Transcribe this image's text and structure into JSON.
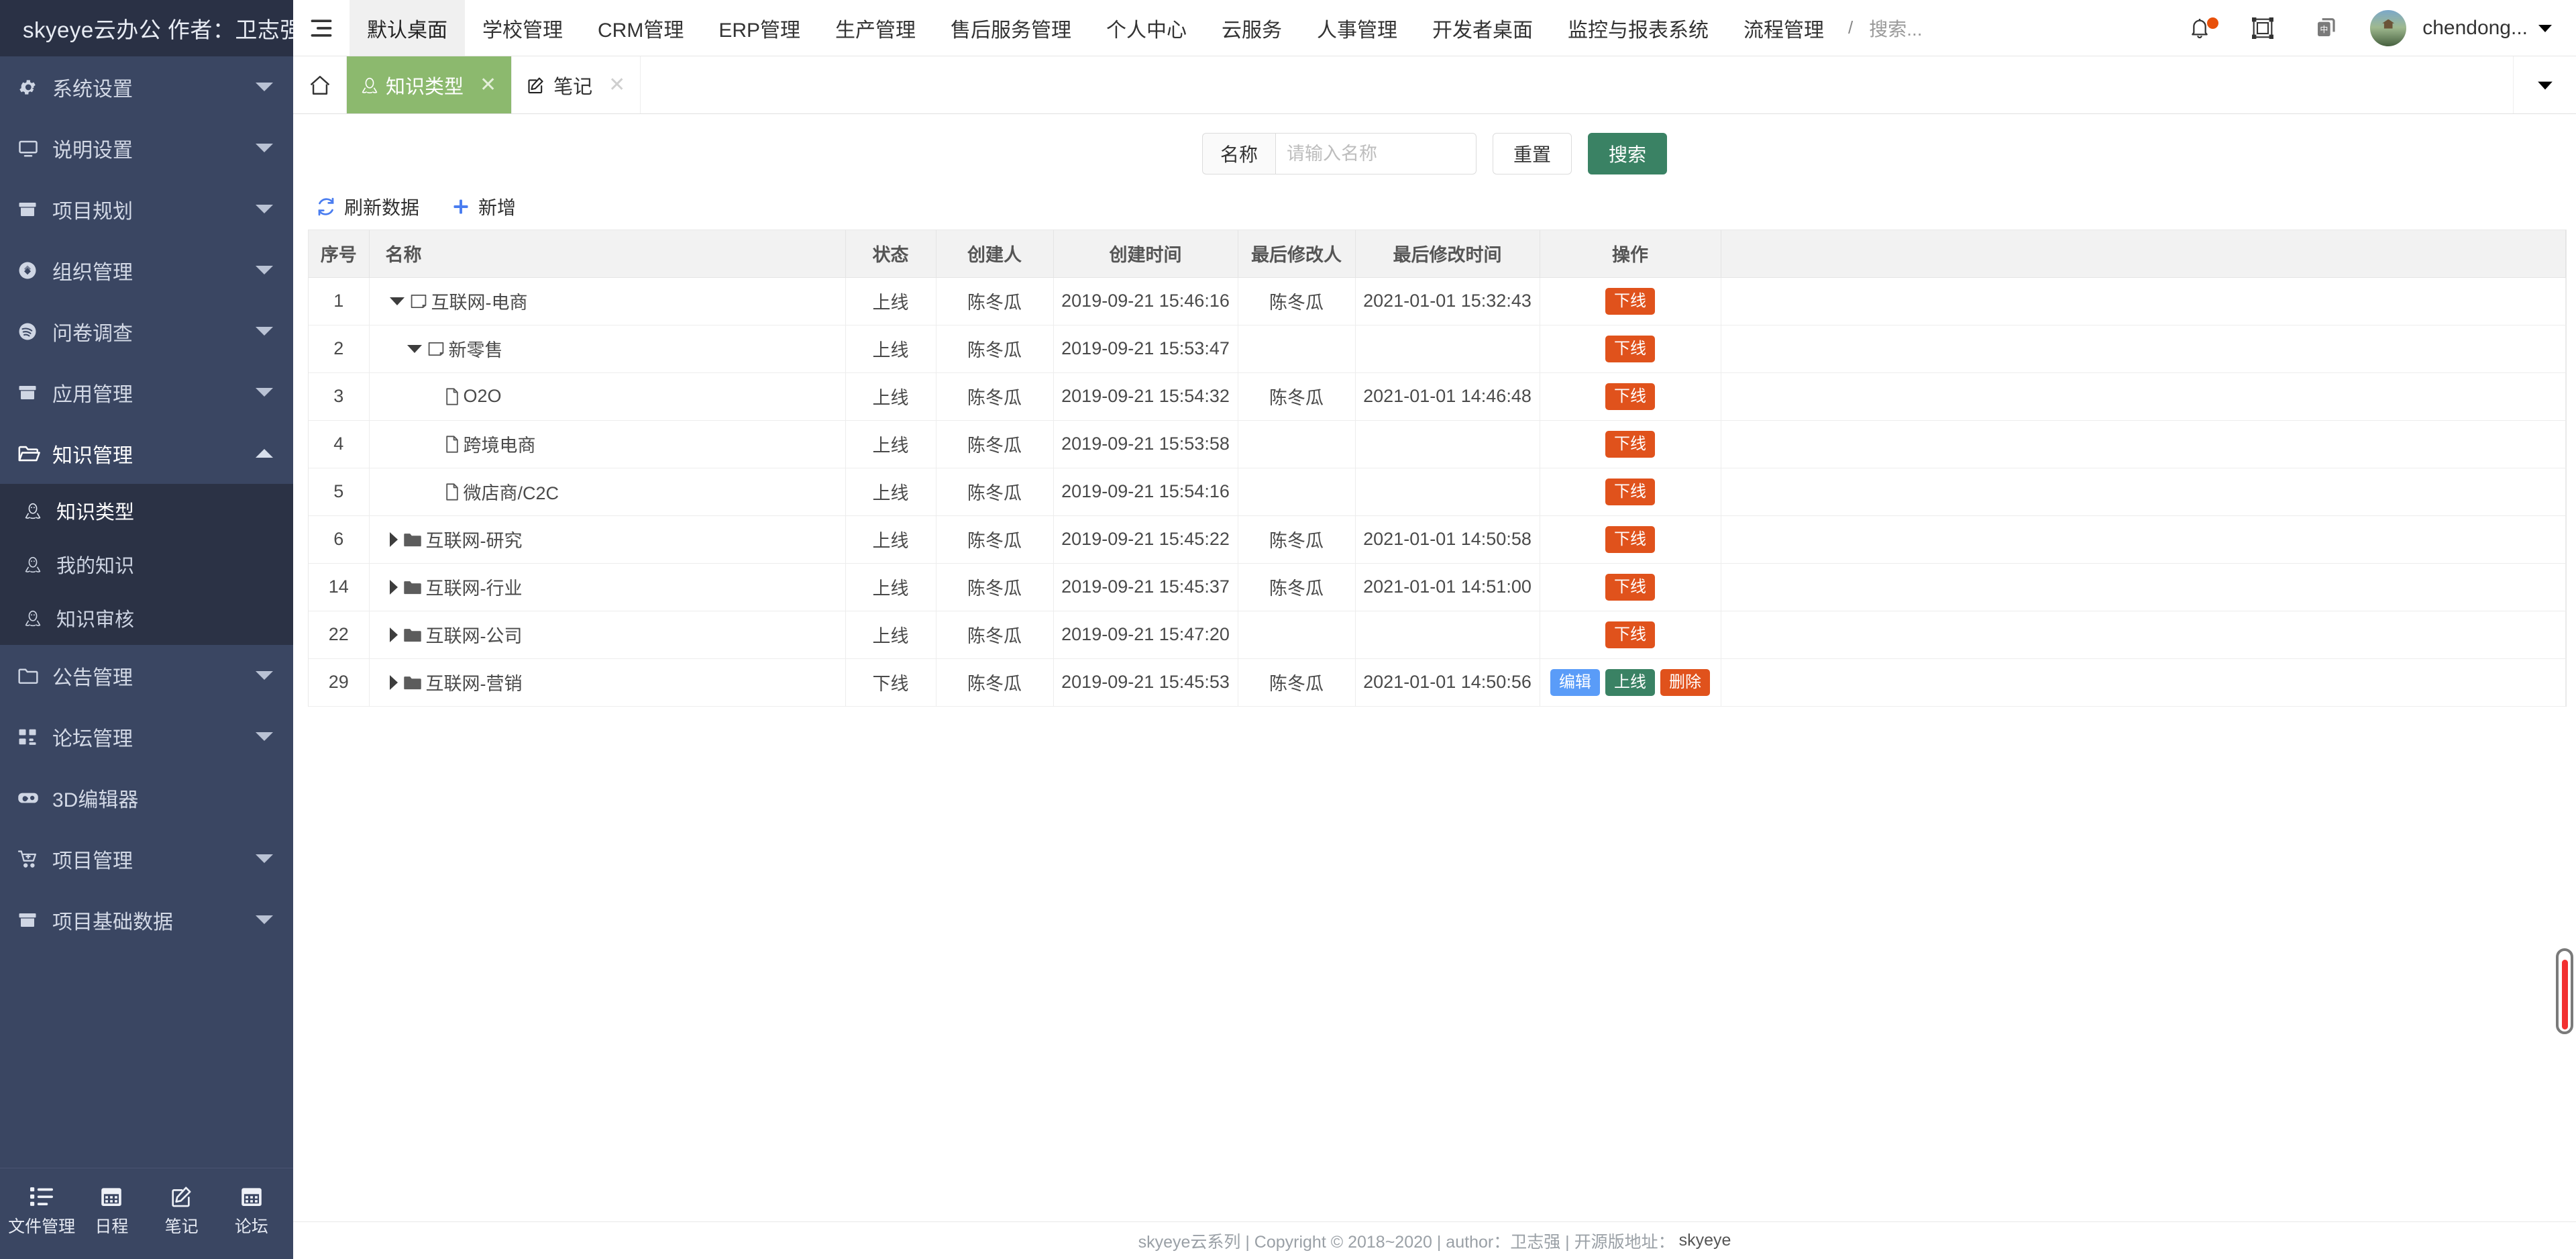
{
  "brand": {
    "title": "skyeye云办公 作者：卫志强"
  },
  "topnav": {
    "hamburger_icon": "hamburger-icon",
    "items": [
      {
        "label": "默认桌面",
        "active": true
      },
      {
        "label": "学校管理",
        "active": false
      },
      {
        "label": "CRM管理",
        "active": false
      },
      {
        "label": "ERP管理",
        "active": false
      },
      {
        "label": "生产管理",
        "active": false
      },
      {
        "label": "售后服务管理",
        "active": false
      },
      {
        "label": "个人中心",
        "active": false
      },
      {
        "label": "云服务",
        "active": false
      },
      {
        "label": "人事管理",
        "active": false
      },
      {
        "label": "开发者桌面",
        "active": false
      },
      {
        "label": "监控与报表系统",
        "active": false
      },
      {
        "label": "流程管理",
        "active": false
      }
    ],
    "separator": "/",
    "search_placeholder": "搜索...",
    "icons": {
      "bell": "bell-icon",
      "fullscreen": "fullscreen-icon",
      "language": "language-icon"
    },
    "badge_color": "#e8500a",
    "username": "chendong...",
    "user_caret": "chevron-down-icon"
  },
  "sidebar": {
    "items": [
      {
        "label": "系统设置",
        "icon": "gear-icon",
        "expandable": true,
        "expanded": false
      },
      {
        "label": "说明设置",
        "icon": "monitor-icon",
        "expandable": true,
        "expanded": false
      },
      {
        "label": "项目规划",
        "icon": "archive-icon",
        "expandable": true,
        "expanded": false
      },
      {
        "label": "组织管理",
        "icon": "badge-icon",
        "expandable": true,
        "expanded": false
      },
      {
        "label": "问卷调查",
        "icon": "survey-icon",
        "expandable": true,
        "expanded": false
      },
      {
        "label": "应用管理",
        "icon": "archive-icon",
        "expandable": true,
        "expanded": false
      },
      {
        "label": "知识管理",
        "icon": "folder-open-icon",
        "expandable": true,
        "expanded": true
      },
      {
        "label": "公告管理",
        "icon": "folder-icon",
        "expandable": true,
        "expanded": false
      },
      {
        "label": "论坛管理",
        "icon": "sitemap-icon",
        "expandable": true,
        "expanded": false
      },
      {
        "label": "3D编辑器",
        "icon": "vr-icon",
        "expandable": false,
        "expanded": false
      },
      {
        "label": "项目管理",
        "icon": "cart-icon",
        "expandable": true,
        "expanded": false
      },
      {
        "label": "项目基础数据",
        "icon": "archive-icon",
        "expandable": true,
        "expanded": false
      }
    ],
    "knowledge_submenu": [
      {
        "label": "知识类型",
        "icon": "penguin-icon",
        "selected": true
      },
      {
        "label": "我的知识",
        "icon": "penguin-icon",
        "selected": false
      },
      {
        "label": "知识审核",
        "icon": "penguin-icon",
        "selected": false
      }
    ],
    "quick_buttons": [
      {
        "label": "文件管理",
        "icon": "list-icon"
      },
      {
        "label": "日程",
        "icon": "calendar-icon"
      },
      {
        "label": "笔记",
        "icon": "edit-note-icon"
      },
      {
        "label": "论坛",
        "icon": "calendar-icon"
      }
    ]
  },
  "tabs": {
    "home_icon": "home-icon",
    "items": [
      {
        "label": "知识类型",
        "icon": "penguin-icon",
        "active": true,
        "close_icon": "close-icon"
      },
      {
        "label": "笔记",
        "icon": "edit-note-icon",
        "active": false,
        "close_icon": "close-icon"
      }
    ],
    "overflow_icon": "chevron-down-icon"
  },
  "filter": {
    "name_label": "名称",
    "name_value": "",
    "name_placeholder": "请输入名称",
    "reset_label": "重置",
    "search_label": "搜索"
  },
  "toolbar": {
    "refresh_label": "刷新数据",
    "refresh_icon": "refresh-icon",
    "add_label": "新增",
    "add_icon": "plus-icon"
  },
  "table": {
    "columns": [
      "序号",
      "名称",
      "状态",
      "创建人",
      "创建时间",
      "最后修改人",
      "最后修改时间",
      "操作"
    ],
    "rows": [
      {
        "seq": "1",
        "name": "互联网-电商",
        "indent": 0,
        "twisty": "down",
        "node_icon": "note-icon",
        "status": "上线",
        "status_type": "online",
        "creator": "陈冬瓜",
        "created": "2019-09-21 15:46:16",
        "modifier": "陈冬瓜",
        "modified": "2021-01-01 15:32:43",
        "actions": [
          {
            "label": "下线",
            "kind": "offline"
          }
        ]
      },
      {
        "seq": "2",
        "name": "新零售",
        "indent": 1,
        "twisty": "down",
        "node_icon": "note-icon",
        "status": "上线",
        "status_type": "online",
        "creator": "陈冬瓜",
        "created": "2019-09-21 15:53:47",
        "modifier": "",
        "modified": "",
        "actions": [
          {
            "label": "下线",
            "kind": "offline"
          }
        ]
      },
      {
        "seq": "3",
        "name": "O2O",
        "indent": 2,
        "twisty": "blank",
        "node_icon": "file-icon",
        "status": "上线",
        "status_type": "online",
        "creator": "陈冬瓜",
        "created": "2019-09-21 15:54:32",
        "modifier": "陈冬瓜",
        "modified": "2021-01-01 14:46:48",
        "actions": [
          {
            "label": "下线",
            "kind": "offline"
          }
        ]
      },
      {
        "seq": "4",
        "name": "跨境电商",
        "indent": 2,
        "twisty": "blank",
        "node_icon": "file-icon",
        "status": "上线",
        "status_type": "online",
        "creator": "陈冬瓜",
        "created": "2019-09-21 15:53:58",
        "modifier": "",
        "modified": "",
        "actions": [
          {
            "label": "下线",
            "kind": "offline"
          }
        ]
      },
      {
        "seq": "5",
        "name": "微店商/C2C",
        "indent": 2,
        "twisty": "blank",
        "node_icon": "file-icon",
        "status": "上线",
        "status_type": "online",
        "creator": "陈冬瓜",
        "created": "2019-09-21 15:54:16",
        "modifier": "",
        "modified": "",
        "actions": [
          {
            "label": "下线",
            "kind": "offline"
          }
        ]
      },
      {
        "seq": "6",
        "name": "互联网-研究",
        "indent": 0,
        "twisty": "right",
        "node_icon": "folder-solid-icon",
        "status": "上线",
        "status_type": "online",
        "creator": "陈冬瓜",
        "created": "2019-09-21 15:45:22",
        "modifier": "陈冬瓜",
        "modified": "2021-01-01 14:50:58",
        "actions": [
          {
            "label": "下线",
            "kind": "offline"
          }
        ]
      },
      {
        "seq": "14",
        "name": "互联网-行业",
        "indent": 0,
        "twisty": "right",
        "node_icon": "folder-solid-icon",
        "status": "上线",
        "status_type": "online",
        "creator": "陈冬瓜",
        "created": "2019-09-21 15:45:37",
        "modifier": "陈冬瓜",
        "modified": "2021-01-01 14:51:00",
        "actions": [
          {
            "label": "下线",
            "kind": "offline"
          }
        ]
      },
      {
        "seq": "22",
        "name": "互联网-公司",
        "indent": 0,
        "twisty": "right",
        "node_icon": "folder-solid-icon",
        "status": "上线",
        "status_type": "online",
        "creator": "陈冬瓜",
        "created": "2019-09-21 15:47:20",
        "modifier": "",
        "modified": "",
        "actions": [
          {
            "label": "下线",
            "kind": "offline"
          }
        ]
      },
      {
        "seq": "29",
        "name": "互联网-营销",
        "indent": 0,
        "twisty": "right",
        "node_icon": "folder-solid-icon",
        "status": "下线",
        "status_type": "offline",
        "creator": "陈冬瓜",
        "created": "2019-09-21 15:45:53",
        "modifier": "陈冬瓜",
        "modified": "2021-01-01 14:50:56",
        "actions": [
          {
            "label": "编辑",
            "kind": "edit"
          },
          {
            "label": "上线",
            "kind": "online"
          },
          {
            "label": "删除",
            "kind": "delete"
          }
        ]
      }
    ]
  },
  "footer": {
    "text": "skyeye云系列 | Copyright © 2018~2020 | author：卫志强 | 开源版地址：",
    "link": "skyeye"
  },
  "colors": {
    "sidebar_bg": "#3a4662",
    "sidebar_sub_bg": "#2b3245",
    "tab_active": "#8cb96e",
    "primary": "#3a8264",
    "danger": "#e0521c",
    "status_online": "#5b8c29",
    "status_offline": "#d9001b"
  }
}
